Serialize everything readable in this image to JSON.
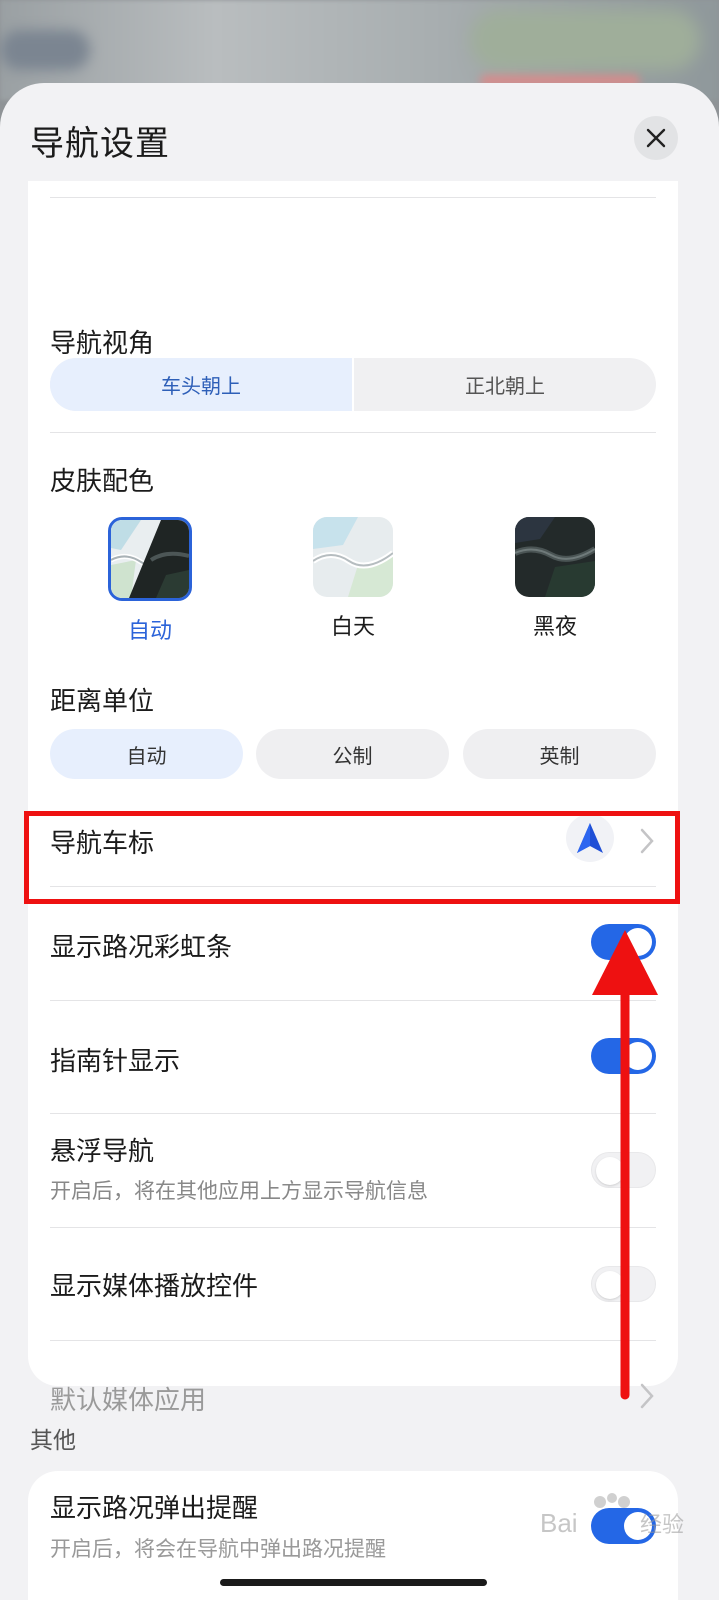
{
  "sheet": {
    "title": "导航设置"
  },
  "orientation": {
    "label": "导航视角",
    "options": [
      "车头朝上",
      "正北朝上"
    ],
    "selected": "车头朝上"
  },
  "skin": {
    "label": "皮肤配色",
    "options": [
      "自动",
      "白天",
      "黑夜"
    ],
    "selected": "自动"
  },
  "distance_unit": {
    "label": "距离单位",
    "options": [
      "自动",
      "公制",
      "英制"
    ],
    "selected": "自动"
  },
  "nav_icon": {
    "label": "导航车标"
  },
  "rainbow_bar": {
    "label": "显示路况彩虹条",
    "enabled": true
  },
  "compass": {
    "label": "指南针显示",
    "enabled": true
  },
  "floating_nav": {
    "label": "悬浮导航",
    "sub": "开启后，将在其他应用上方显示导航信息",
    "enabled": false
  },
  "media_controls": {
    "label": "显示媒体播放控件",
    "enabled": false
  },
  "default_media": {
    "label": "默认媒体应用"
  },
  "other": {
    "label": "其他",
    "traffic_popup": {
      "label": "显示路况弹出提醒",
      "sub": "开启后，将会在导航中弹出路况提醒",
      "enabled": true
    }
  },
  "colors": {
    "accent": "#2467e6",
    "annotation": "#ee1111"
  }
}
